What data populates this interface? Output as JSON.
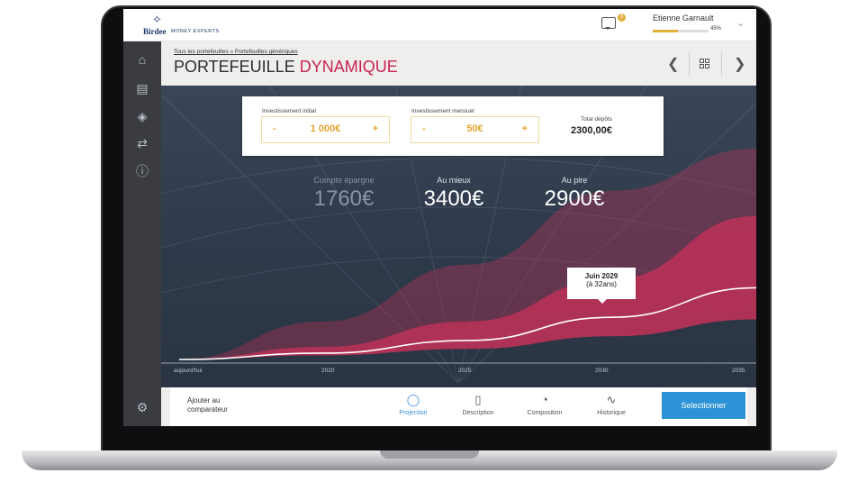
{
  "brand": {
    "name": "Birdee",
    "tagline": "MONEY EXPERTS"
  },
  "topbar": {
    "notif_count": "3",
    "user_name": "Etienne Garnault",
    "user_progress": "45%",
    "user_progress_value": 0.45
  },
  "sidebar": {
    "icons": [
      "home-icon",
      "wallet-icon",
      "layers-icon",
      "transfer-icon",
      "help-icon",
      "settings-icon"
    ]
  },
  "header": {
    "breadcrumb": "Tous les portefeuilles » Portefeuilles génériques",
    "title_main": "PORTEFEUILLE",
    "title_accent": "DYNAMIQUE"
  },
  "inputs": {
    "initial_label": "Investissement initial",
    "initial_value": "1 000€",
    "monthly_label": "Investissement mensuel",
    "monthly_value": "50€",
    "minus": "-",
    "plus": "+",
    "total_label": "Total dépôts",
    "total_value": "2300,00€"
  },
  "stats": {
    "savings_label": "Compte épargne",
    "savings_value": "1760€",
    "best_label": "Au mieux",
    "best_value": "3400€",
    "worst_label": "Au pire",
    "worst_value": "2900€"
  },
  "tooltip": {
    "date": "Juin 2029",
    "age": "(à 32ans)"
  },
  "chart_data": {
    "type": "area",
    "x": [
      "aujourd'hui",
      "2020",
      "2025",
      "2030",
      "2035"
    ],
    "x_ticks": [
      "aujourd'hui",
      "2020",
      "2025",
      "2030",
      "2035"
    ],
    "series": [
      {
        "values": [
          0,
          0.06,
          0.18,
          0.38,
          0.68
        ]
      },
      {
        "values": [
          0,
          0.18,
          0.45,
          0.8,
          1.0
        ]
      },
      {
        "values": [
          0,
          0.03,
          0.09,
          0.2,
          0.34
        ]
      },
      {
        "values": [
          0,
          0.02,
          0.05,
          0.11,
          0.19
        ]
      }
    ],
    "highlight_point": {
      "x": "2029",
      "y": 0.31
    },
    "colors": {
      "band": "#c8305a",
      "line": "#ffffff",
      "marker": "#3c8fd6"
    }
  },
  "bottom": {
    "compare_label": "Ajouter au\ncomparateur",
    "tabs": [
      {
        "label": "Projection",
        "icon": "projection-icon"
      },
      {
        "label": "Description",
        "icon": "document-icon"
      },
      {
        "label": "Composition",
        "icon": "pie-icon"
      },
      {
        "label": "Historique",
        "icon": "history-icon"
      }
    ],
    "select_label": "Selectionner"
  },
  "colors": {
    "accent": "#c8234f",
    "gold": "#e3a52e",
    "blue": "#2e93d6",
    "sidebar": "#3a3c42"
  }
}
